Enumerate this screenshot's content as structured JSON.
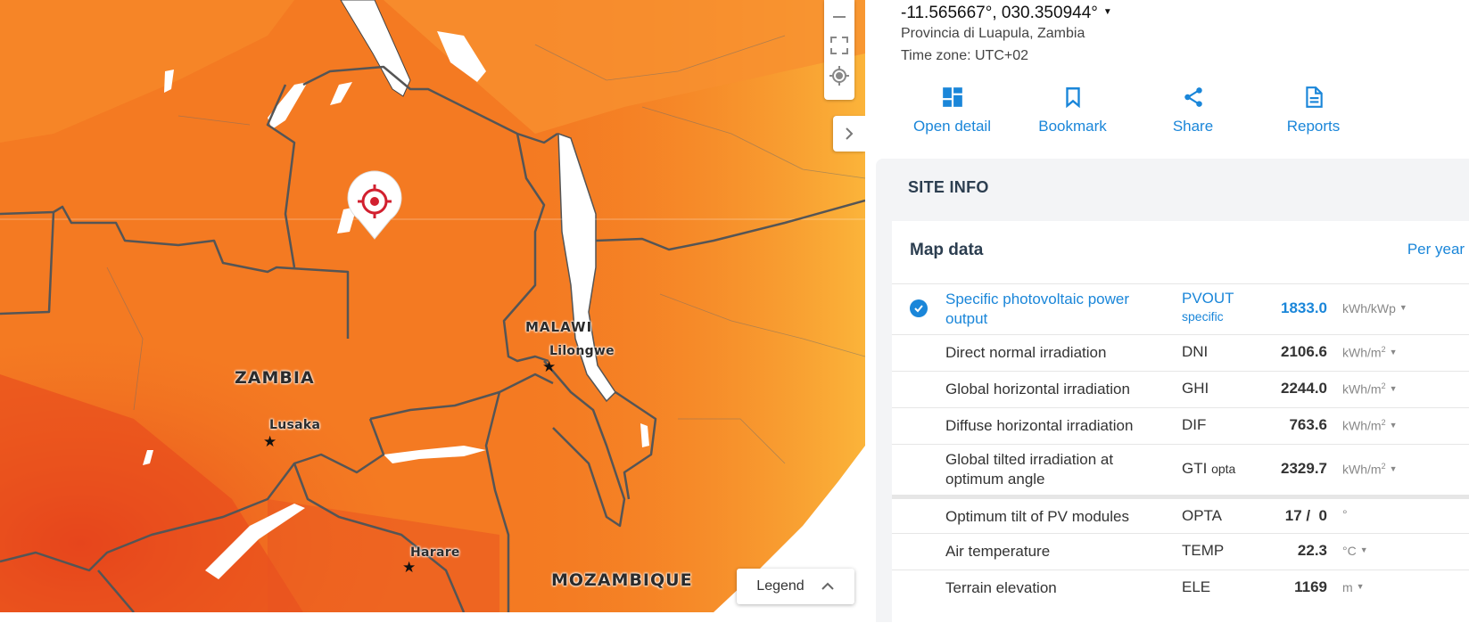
{
  "map": {
    "country_labels": [
      "ZAMBIA",
      "MALAWI",
      "MOZAMBIQUE"
    ],
    "city_labels": [
      "Lusaka",
      "Lilongwe",
      "Harare"
    ],
    "legend_label": "Legend",
    "colors": {
      "land_main": "#f47a22",
      "land_light": "#f9a62e",
      "land_dark": "#ea4f1c",
      "water": "#ffffff",
      "border": "#555555"
    }
  },
  "location": {
    "coordinates": "-11.565667°, 030.350944°",
    "region": "Provincia di Luapula, Zambia",
    "timezone": "Time zone: UTC+02"
  },
  "actions": [
    {
      "label": "Open detail",
      "icon": "dashboard-icon"
    },
    {
      "label": "Bookmark",
      "icon": "bookmark-icon"
    },
    {
      "label": "Share",
      "icon": "share-icon"
    },
    {
      "label": "Reports",
      "icon": "document-icon"
    }
  ],
  "site_info": {
    "title": "SITE INFO",
    "map_data_title": "Map data",
    "period": "Per year",
    "rows": [
      {
        "name": "Specific photovoltaic power output",
        "abbr": "PVOUT",
        "abbr_sub": "specific",
        "value": "1833.0",
        "unit": "kWh/kWp",
        "unit_sup": ""
      },
      {
        "name": "Direct normal irradiation",
        "abbr": "DNI",
        "abbr_sub": "",
        "value": "2106.6",
        "unit": "kWh/m",
        "unit_sup": "2"
      },
      {
        "name": "Global horizontal irradiation",
        "abbr": "GHI",
        "abbr_sub": "",
        "value": "2244.0",
        "unit": "kWh/m",
        "unit_sup": "2"
      },
      {
        "name": "Diffuse horizontal irradiation",
        "abbr": "DIF",
        "abbr_sub": "",
        "value": "763.6",
        "unit": "kWh/m",
        "unit_sup": "2"
      },
      {
        "name": "Global tilted irradiation at optimum angle",
        "abbr": "GTI",
        "abbr_sub": "opta",
        "value": "2329.7",
        "unit": "kWh/m",
        "unit_sup": "2"
      },
      {
        "name": "Optimum tilt of PV modules",
        "abbr": "OPTA",
        "abbr_sub": "",
        "value": "17 /  0",
        "unit": "°",
        "unit_sup": ""
      },
      {
        "name": "Air temperature",
        "abbr": "TEMP",
        "abbr_sub": "",
        "value": "22.3",
        "unit": "°C",
        "unit_sup": ""
      },
      {
        "name": "Terrain elevation",
        "abbr": "ELE",
        "abbr_sub": "",
        "value": "1169",
        "unit": "m",
        "unit_sup": ""
      }
    ]
  }
}
